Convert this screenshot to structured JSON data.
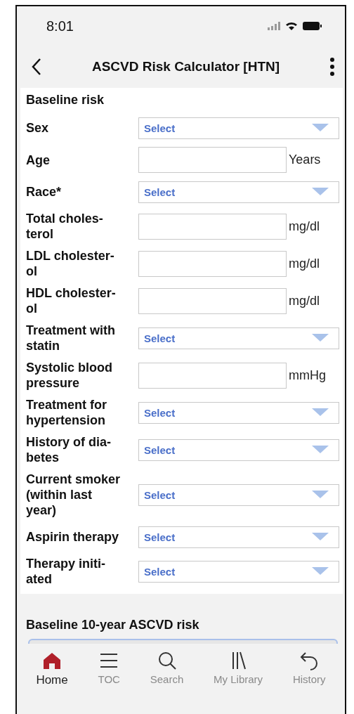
{
  "status_bar": {
    "time": "8:01"
  },
  "header": {
    "title": "ASCVD Risk Calculator [HTN]"
  },
  "form": {
    "section_title": "Baseline risk",
    "fields": [
      {
        "kind": "select",
        "label": "Sex",
        "prompt": "Select"
      },
      {
        "kind": "input",
        "label": "Age",
        "unit": "Years"
      },
      {
        "kind": "select",
        "label": "Race*",
        "prompt": "Select"
      },
      {
        "kind": "input",
        "label": "Total choles-\nterol",
        "unit": "mg/dl"
      },
      {
        "kind": "input",
        "label": "LDL cholester-\nol",
        "unit": "mg/dl"
      },
      {
        "kind": "input",
        "label": "HDL cholester-\nol",
        "unit": "mg/dl"
      },
      {
        "kind": "select",
        "label": "Treatment with\nstatin",
        "prompt": "Select"
      },
      {
        "kind": "input",
        "label": "Systolic blood\npressure",
        "unit": "mmHg"
      },
      {
        "kind": "select",
        "label": "Treatment for\nhypertension",
        "prompt": "Select"
      },
      {
        "kind": "select",
        "label": "History of dia-\nbetes",
        "prompt": "Select"
      },
      {
        "kind": "select",
        "label": "Current smoker\n(within last\nyear)",
        "prompt": "Select"
      },
      {
        "kind": "select",
        "label": "Aspirin therapy",
        "prompt": "Select"
      },
      {
        "kind": "select",
        "label": "Therapy initi-\nated",
        "prompt": "Select"
      }
    ]
  },
  "result": {
    "title": "Baseline 10-year ASCVD risk"
  },
  "tab_bar": [
    {
      "label": "Home",
      "selected": true
    },
    {
      "label": "TOC",
      "selected": false
    },
    {
      "label": "Search",
      "selected": false
    },
    {
      "label": "My Library",
      "selected": false
    },
    {
      "label": "History",
      "selected": false
    }
  ]
}
